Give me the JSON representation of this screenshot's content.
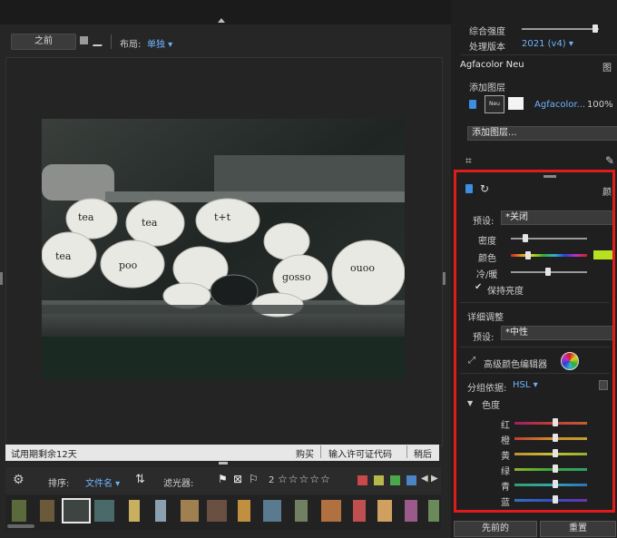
{
  "toolbar": {
    "before_label": "之前",
    "layout_label": "布局:",
    "layout_value": "单独"
  },
  "statusbar": {
    "trial_text": "试用期剩余12天",
    "buy_label": "购买",
    "license_label": "输入许可证代码",
    "back_label": "稍后"
  },
  "filterbar": {
    "sort_label": "排序:",
    "sort_value": "文件名",
    "filter_label": "滤光器:",
    "rating_count": "2",
    "color_tags": [
      "#c94848",
      "#b8b84a",
      "#4aa84a",
      "#4a84c4"
    ]
  },
  "right": {
    "overall_strength": "综合强度",
    "process_version_label": "处理版本",
    "process_version_value": "2021 (v4)",
    "film_name": "Agfacolor Neu",
    "film_right": "图",
    "add_layer_title": "添加图层",
    "layer_name": "Agfacolor...",
    "layer_opacity": "100%",
    "add_layer_dropdown": "添加图层...",
    "color_title": "颜",
    "preset_label": "预设:",
    "preset_value": "*关闭",
    "density_label": "密度",
    "hue_label": "颜色",
    "warmth_label": "冷/暖",
    "preserve_label": "保持亮度",
    "detail_title": "详细调整",
    "preset2_label": "预设:",
    "preset2_value": "*中性",
    "advanced_editor": "高级颜色编辑器",
    "group_label": "分组依据:",
    "group_value": "HSL",
    "hue_section": "色度",
    "colors": [
      {
        "label": "红",
        "color": "#c43a3a"
      },
      {
        "label": "橙",
        "color": "#d08a2a"
      },
      {
        "label": "黄",
        "color": "#c8c030"
      },
      {
        "label": "绿",
        "color": "#3aa83a"
      },
      {
        "label": "青",
        "color": "#30a8a8"
      },
      {
        "label": "蓝",
        "color": "#3050c0"
      }
    ],
    "previous_button": "先前的",
    "reset_button": "重置"
  }
}
